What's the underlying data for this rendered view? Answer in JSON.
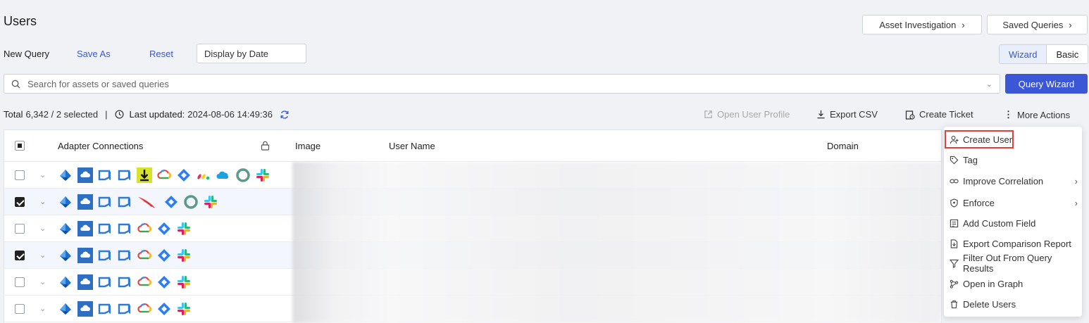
{
  "page": {
    "title": "Users"
  },
  "header_buttons": {
    "asset_investigation": "Asset Investigation",
    "saved_queries": "Saved Queries"
  },
  "query_bar": {
    "new_query": "New Query",
    "save_as": "Save As",
    "reset": "Reset",
    "display_by_date": "Display by Date"
  },
  "mode_toggle": {
    "wizard": "Wizard",
    "basic": "Basic"
  },
  "search": {
    "placeholder": "Search for assets or saved queries"
  },
  "query_wizard": "Query Wizard",
  "stats": {
    "total_label": "Total",
    "total_value": "6,342 / 2 selected",
    "separator": "|",
    "last_updated_label": "Last updated:",
    "last_updated_value": "2024-08-06 14:49:36"
  },
  "actions": {
    "open_user_profile": "Open User Profile",
    "export_csv": "Export CSV",
    "create_ticket": "Create Ticket",
    "more_actions": "More Actions"
  },
  "table": {
    "columns": {
      "adapters": "Adapter Connections",
      "image": "Image",
      "user_name": "User Name",
      "domain": "Domain"
    },
    "rows": [
      {
        "checked": false,
        "icons": [
          "azure-ad-icon",
          "cloud-icon",
          "lync-icon",
          "lync-icon",
          "download-icon",
          "gcp-icon",
          "jira-icon",
          "monday-icon",
          "salesforce-icon",
          "okta-icon",
          "slack-icon"
        ]
      },
      {
        "checked": true,
        "icons": [
          "azure-ad-icon",
          "cloud-icon",
          "lync-icon",
          "lync-icon",
          "crowdstrike-icon",
          "jira-icon",
          "okta-icon",
          "slack-icon"
        ]
      },
      {
        "checked": false,
        "icons": [
          "azure-ad-icon",
          "cloud-icon",
          "lync-icon",
          "lync-icon",
          "gcp-icon",
          "jira-icon",
          "slack-icon"
        ]
      },
      {
        "checked": true,
        "icons": [
          "azure-ad-icon",
          "cloud-icon",
          "lync-icon",
          "lync-icon",
          "gcp-icon",
          "jira-icon",
          "slack-icon"
        ]
      },
      {
        "checked": false,
        "icons": [
          "azure-ad-icon",
          "cloud-icon",
          "lync-icon",
          "lync-icon",
          "gcp-icon",
          "jira-icon",
          "slack-icon"
        ]
      },
      {
        "checked": false,
        "icons": [
          "azure-ad-icon",
          "cloud-icon",
          "lync-icon",
          "lync-icon",
          "gcp-icon",
          "jira-icon",
          "slack-icon"
        ]
      }
    ]
  },
  "more_actions_menu": {
    "items": [
      {
        "label": "Create User",
        "icon": "user-plus-icon"
      },
      {
        "label": "Tag",
        "icon": "tag-icon"
      },
      {
        "label": "Improve Correlation",
        "icon": "link-icon",
        "submenu": true
      },
      {
        "label": "Enforce",
        "icon": "shield-icon",
        "submenu": true
      },
      {
        "label": "Add Custom Field",
        "icon": "custom-field-icon"
      },
      {
        "label": "Export Comparison Report",
        "icon": "report-icon"
      },
      {
        "label": "Filter Out From Query Results",
        "icon": "filter-icon"
      },
      {
        "label": "Open in Graph",
        "icon": "graph-icon"
      },
      {
        "label": "Delete Users",
        "icon": "trash-icon"
      }
    ]
  },
  "colors": {
    "accent": "#3b57d6",
    "highlight": "#e0403a"
  }
}
